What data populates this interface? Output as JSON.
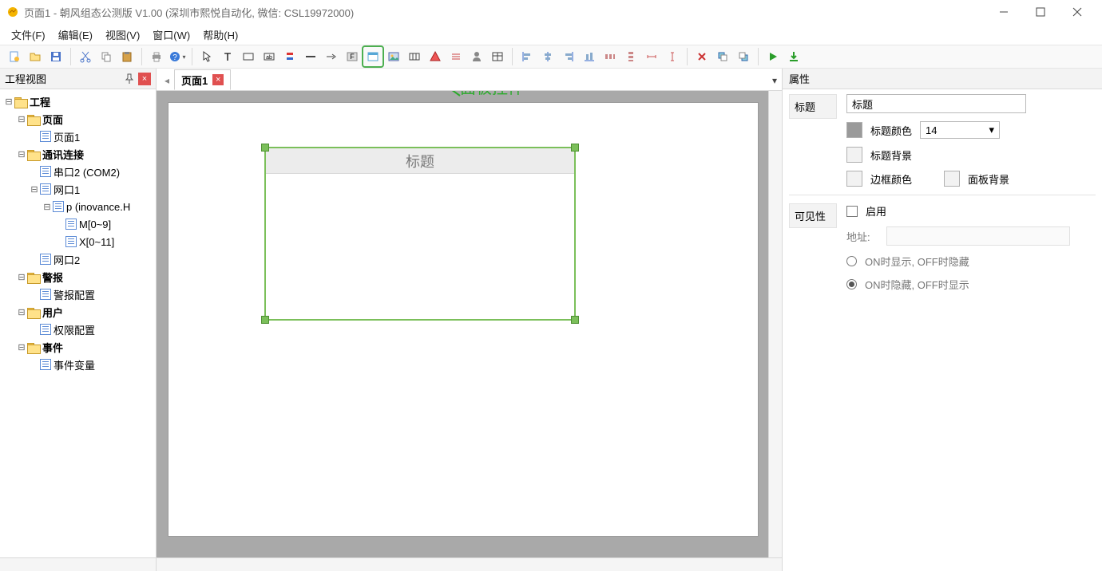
{
  "title": "页面1 - 朝风组态公测版 V1.00 (深圳市熙悦自动化, 微信: CSL19972000)",
  "menu": {
    "items": [
      "文件(F)",
      "编辑(E)",
      "视图(V)",
      "窗口(W)",
      "帮助(H)"
    ]
  },
  "toolbar_icons": [
    "new-file",
    "open-file",
    "save-file",
    "|",
    "cut",
    "copy",
    "paste",
    "|",
    "print",
    "help",
    "|",
    "pointer",
    "text-tool",
    "rect",
    "text-box",
    "indicator",
    "line",
    "arrow",
    "formula",
    "panel",
    "image",
    "grid-display",
    "alarm-icon",
    "numeric",
    "user-icon",
    "table-control",
    "|",
    "align-left",
    "align-center-h",
    "align-right",
    "align-bottom",
    "distribute-h",
    "distribute-v",
    "same-width",
    "same-height",
    "|",
    "ungroup",
    "bring-forward",
    "send-backward",
    "|",
    "run",
    "download"
  ],
  "left_panel": {
    "title": "工程视图",
    "tree": [
      {
        "d": 0,
        "t": "toggle",
        "exp": "-"
      },
      {
        "d": 0,
        "t": "folder",
        "label": "工程",
        "bold": true
      },
      {
        "d": 1,
        "t": "toggle",
        "exp": "-"
      },
      {
        "d": 1,
        "t": "folder",
        "label": "页面",
        "bold": true
      },
      {
        "d": 2,
        "t": "file",
        "label": "页面1"
      },
      {
        "d": 1,
        "t": "toggle",
        "exp": "-"
      },
      {
        "d": 1,
        "t": "folder",
        "label": "通讯连接",
        "bold": true
      },
      {
        "d": 2,
        "t": "file",
        "label": "串口2 (COM2)"
      },
      {
        "d": 2,
        "t": "toggle",
        "exp": "-"
      },
      {
        "d": 2,
        "t": "file",
        "label": "网口1"
      },
      {
        "d": 3,
        "t": "toggle",
        "exp": "-"
      },
      {
        "d": 3,
        "t": "file",
        "label": "p (inovance.H"
      },
      {
        "d": 4,
        "t": "file",
        "label": "M[0~9]"
      },
      {
        "d": 4,
        "t": "file",
        "label": "X[0~11]"
      },
      {
        "d": 2,
        "t": "file",
        "label": "网口2"
      },
      {
        "d": 1,
        "t": "toggle",
        "exp": "-"
      },
      {
        "d": 1,
        "t": "folder",
        "label": "警报",
        "bold": true
      },
      {
        "d": 2,
        "t": "file",
        "label": "警报配置"
      },
      {
        "d": 1,
        "t": "toggle",
        "exp": "-"
      },
      {
        "d": 1,
        "t": "folder",
        "label": "用户",
        "bold": true
      },
      {
        "d": 2,
        "t": "file",
        "label": "权限配置"
      },
      {
        "d": 1,
        "t": "toggle",
        "exp": "-"
      },
      {
        "d": 1,
        "t": "folder",
        "label": "事件",
        "bold": true
      },
      {
        "d": 2,
        "t": "file",
        "label": "事件变量"
      }
    ]
  },
  "tabs": {
    "active": "页面1"
  },
  "canvas": {
    "widget_title": "标题",
    "annotation_label": "面板控件"
  },
  "props": {
    "panel_title": "属性",
    "section_title": "标题",
    "title_value": "标题",
    "title_color_label": "标题颜色",
    "title_size_value": "14",
    "title_bg_label": "标题背景",
    "border_color_label": "边框颜色",
    "panel_bg_label": "面板背景",
    "visibility_section": "可见性",
    "enable_label": "启用",
    "address_label": "地址:",
    "radio_on_show": "ON时显示, OFF时隐藏",
    "radio_on_hide": "ON时隐藏, OFF时显示"
  }
}
